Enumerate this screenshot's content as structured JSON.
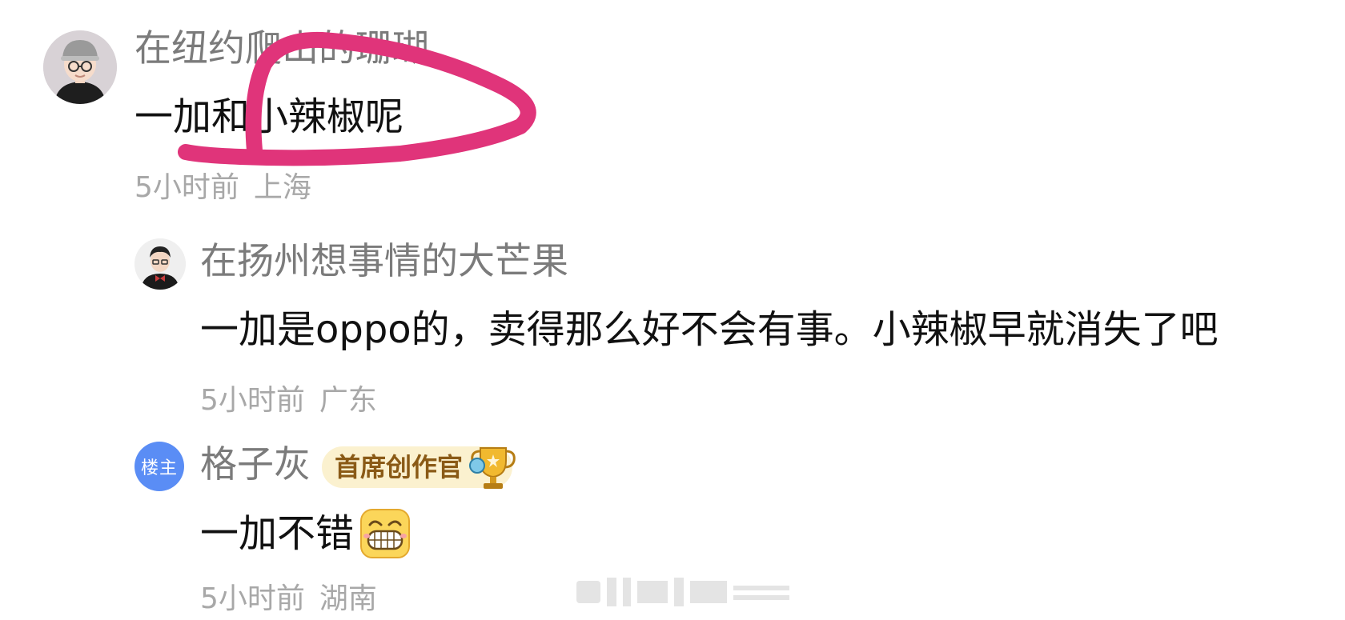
{
  "comments": [
    {
      "username": "在纽约爬山的珊瑚",
      "text": "一加和小辣椒呢",
      "time": "5小时前",
      "location": "上海",
      "avatar_icon": "user-avatar-cap-glasses-icon"
    },
    {
      "username": "在扬州想事情的大芒果",
      "text": "一加是oppo的，卖得那么好不会有事。小辣椒早就消失了吧",
      "time": "5小时前",
      "location": "广东",
      "avatar_icon": "user-avatar-bowtie-icon"
    },
    {
      "username": "格子灰",
      "owner_badge": "楼主",
      "title_badge": "首席创作官",
      "text": "一加不错",
      "emoji_icon": "grinning-face-emoji-icon",
      "time": "5小时前",
      "location": "湖南"
    }
  ],
  "colors": {
    "annotation": "#e0347a",
    "owner_badge": "#5a8df5",
    "title_badge_bg": "#fbf1cf",
    "title_badge_text": "#8a5a16"
  }
}
